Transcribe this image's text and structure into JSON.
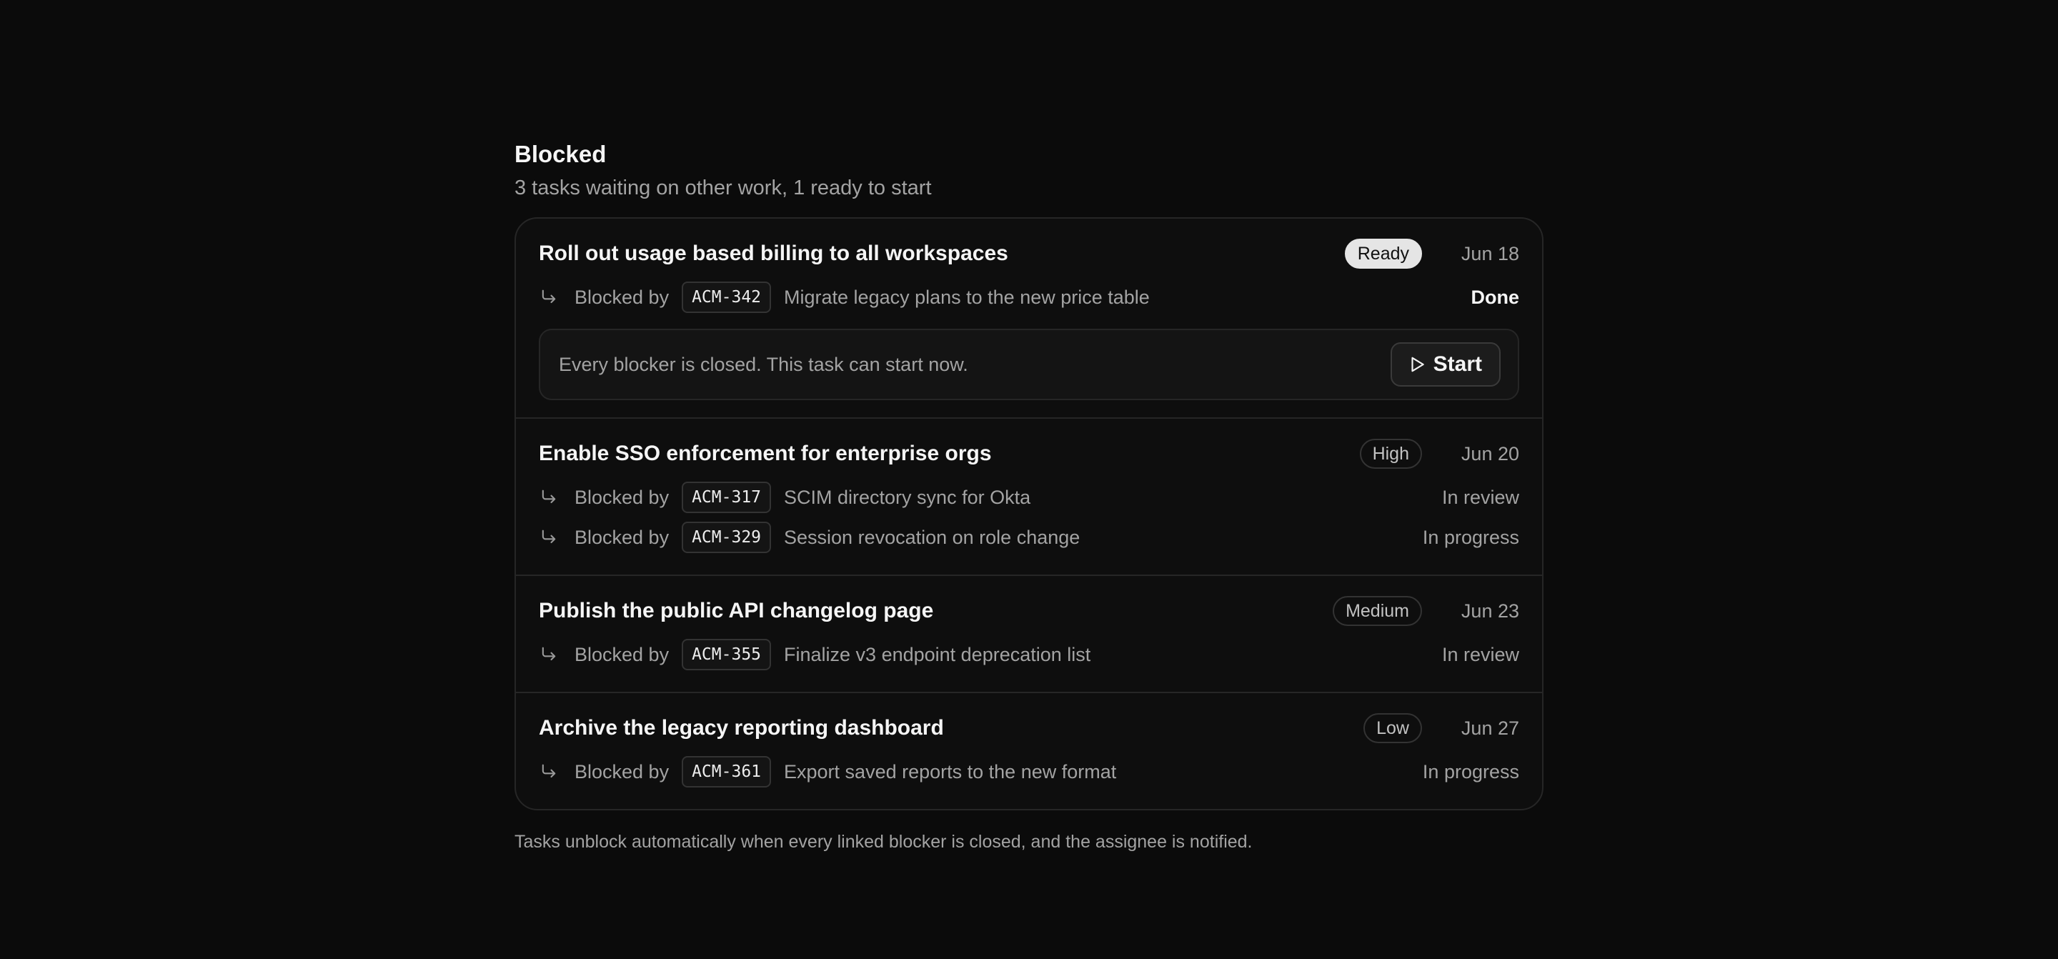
{
  "header": {
    "title": "Blocked",
    "subtitle": "3 tasks waiting on other work, 1 ready to start"
  },
  "tasks": [
    {
      "title": "Roll out usage based billing to all workspaces",
      "badge": "Ready",
      "date": "Jun 18",
      "blockers": [
        {
          "label": "Blocked by",
          "code": "ACM-342",
          "desc": "Migrate legacy plans to the new price table",
          "status": "Done"
        }
      ],
      "ready": {
        "message": "Every blocker is closed. This task can start now.",
        "button_label": "Start"
      }
    },
    {
      "title": "Enable SSO enforcement for enterprise orgs",
      "badge": "High",
      "date": "Jun 20",
      "blockers": [
        {
          "label": "Blocked by",
          "code": "ACM-317",
          "desc": "SCIM directory sync for Okta",
          "status": "In review"
        },
        {
          "label": "Blocked by",
          "code": "ACM-329",
          "desc": "Session revocation on role change",
          "status": "In progress"
        }
      ]
    },
    {
      "title": "Publish the public API changelog page",
      "badge": "Medium",
      "date": "Jun 23",
      "blockers": [
        {
          "label": "Blocked by",
          "code": "ACM-355",
          "desc": "Finalize v3 endpoint deprecation list",
          "status": "In review"
        }
      ]
    },
    {
      "title": "Archive the legacy reporting dashboard",
      "badge": "Low",
      "date": "Jun 27",
      "blockers": [
        {
          "label": "Blocked by",
          "code": "ACM-361",
          "desc": "Export saved reports to the new format",
          "status": "In progress"
        }
      ]
    }
  ],
  "footer": "Tasks unblock automatically when every linked blocker is closed, and the assignee is notified.",
  "icons": {
    "blocker": "corner-down-right-icon",
    "start": "play-icon"
  },
  "colors": {
    "background": "#0b0b0b",
    "ready_badge": "#e5e5e5",
    "text_muted": "#a3a3a3"
  }
}
